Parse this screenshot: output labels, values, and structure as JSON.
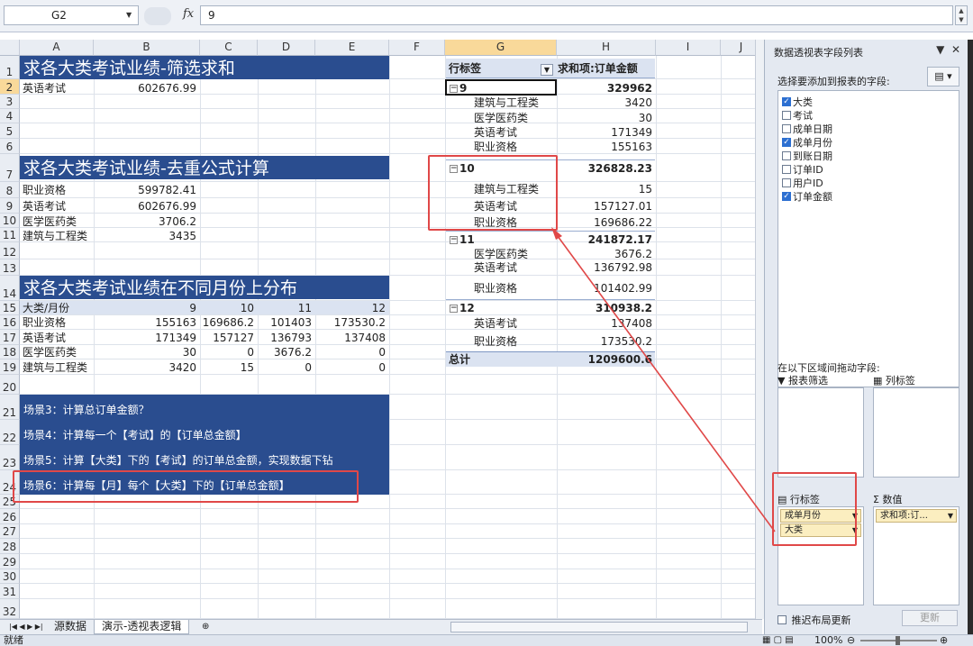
{
  "formula_bar": {
    "name_box": "G2",
    "fx": "fx",
    "formula": "9"
  },
  "columns": [
    "A",
    "B",
    "C",
    "D",
    "E",
    "F",
    "G",
    "H",
    "I",
    "J"
  ],
  "rows": [
    "1",
    "2",
    "3",
    "4",
    "5",
    "6",
    "7",
    "8",
    "9",
    "10",
    "11",
    "12",
    "13",
    "14",
    "15",
    "16",
    "17",
    "18",
    "19",
    "20",
    "21",
    "22",
    "23",
    "24",
    "25",
    "26",
    "27",
    "28",
    "29",
    "30",
    "31",
    "32"
  ],
  "section1": {
    "title": "求各大类考试业绩-筛选求和",
    "label": "英语考试",
    "value": "602676.99"
  },
  "section2": {
    "title": "求各大类考试业绩-去重公式计算",
    "items": [
      {
        "label": "职业资格",
        "value": "599782.41"
      },
      {
        "label": "英语考试",
        "value": "602676.99"
      },
      {
        "label": "医学医药类",
        "value": "3706.2"
      },
      {
        "label": "建筑与工程类",
        "value": "3435"
      }
    ]
  },
  "section3": {
    "title": "求各大类考试业绩在不同月份上分布",
    "header": {
      "label": "大类/月份",
      "months": [
        "9",
        "10",
        "11",
        "12"
      ]
    },
    "rows": [
      {
        "label": "职业资格",
        "values": [
          "155163",
          "169686.2",
          "101403",
          "173530.2"
        ]
      },
      {
        "label": "英语考试",
        "values": [
          "171349",
          "157127",
          "136793",
          "137408"
        ]
      },
      {
        "label": "医学医药类",
        "values": [
          "30",
          "0",
          "3676.2",
          "0"
        ]
      },
      {
        "label": "建筑与工程类",
        "values": [
          "3420",
          "15",
          "0",
          "0"
        ]
      }
    ]
  },
  "scenarios": [
    "场景3：计算总订单金额？",
    "场景4：计算每一个【考试】的【订单总金额】",
    "场景5：计算【大类】下的【考试】的订单总金额，实现数据下钻",
    "场景6：计算每【月】每个【大类】下的【订单总金额】"
  ],
  "pivot": {
    "row_header": "行标签",
    "value_header": "求和项:订单金额",
    "groups": [
      {
        "month": "9",
        "total": "329962",
        "items": [
          {
            "label": "建筑与工程类",
            "value": "3420"
          },
          {
            "label": "医学医药类",
            "value": "30"
          },
          {
            "label": "英语考试",
            "value": "171349"
          },
          {
            "label": "职业资格",
            "value": "155163"
          }
        ]
      },
      {
        "month": "10",
        "total": "326828.23",
        "items": [
          {
            "label": "建筑与工程类",
            "value": "15"
          },
          {
            "label": "英语考试",
            "value": "157127.01"
          },
          {
            "label": "职业资格",
            "value": "169686.22"
          }
        ]
      },
      {
        "month": "11",
        "total": "241872.17",
        "items": [
          {
            "label": "医学医药类",
            "value": "3676.2"
          },
          {
            "label": "英语考试",
            "value": "136792.98"
          },
          {
            "label": "职业资格",
            "value": "101402.99"
          }
        ]
      },
      {
        "month": "12",
        "total": "310938.2",
        "items": [
          {
            "label": "英语考试",
            "value": "137408"
          },
          {
            "label": "职业资格",
            "value": "173530.2"
          }
        ]
      }
    ],
    "grand_total_label": "总计",
    "grand_total": "1209600.6"
  },
  "sheet_tabs": [
    "源数据",
    "演示-透视表逻辑"
  ],
  "status": {
    "ready": "就绪",
    "zoom": "100%"
  },
  "field_pane": {
    "title": "数据透视表字段列表",
    "choose_label": "选择要添加到报表的字段:",
    "fields": [
      {
        "name": "大类",
        "checked": true
      },
      {
        "name": "考试",
        "checked": false
      },
      {
        "name": "成单日期",
        "checked": false
      },
      {
        "name": "成单月份",
        "checked": true
      },
      {
        "name": "到账日期",
        "checked": false
      },
      {
        "name": "订单ID",
        "checked": false
      },
      {
        "name": "用户ID",
        "checked": false
      },
      {
        "name": "订单金额",
        "checked": true
      }
    ],
    "drag_label": "在以下区域间拖动字段:",
    "zones": {
      "filter": "报表筛选",
      "columns": "列标签",
      "rows": "行标签",
      "values": "数值"
    },
    "row_chips": [
      "成单月份",
      "大类"
    ],
    "value_chip": "求和项:订...",
    "defer_label": "推迟布局更新",
    "update_button": "更新"
  }
}
